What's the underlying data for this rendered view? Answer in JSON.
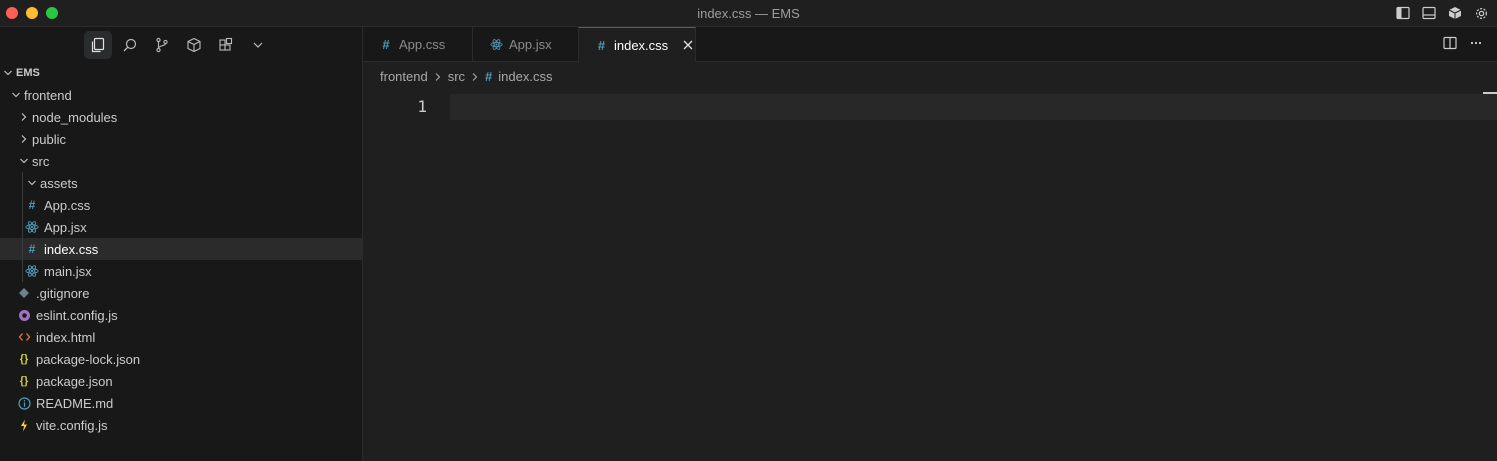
{
  "window": {
    "title": "index.css — EMS"
  },
  "colors": {
    "css_hash": "#519aba",
    "react": "#519aba",
    "json": "#cbcb41",
    "html": "#e37933",
    "eslint": "#a074c4",
    "vite": "#ffd62e",
    "info": "#519aba",
    "gitignore": "#6d8086",
    "accent": "#0078d4"
  },
  "explorer": {
    "root": "EMS",
    "items": [
      {
        "label": "frontend"
      },
      {
        "label": "node_modules"
      },
      {
        "label": "public"
      },
      {
        "label": "src"
      },
      {
        "label": "assets"
      },
      {
        "label": "App.css"
      },
      {
        "label": "App.jsx"
      },
      {
        "label": "index.css"
      },
      {
        "label": "main.jsx"
      },
      {
        "label": ".gitignore"
      },
      {
        "label": "eslint.config.js"
      },
      {
        "label": "index.html"
      },
      {
        "label": "package-lock.json"
      },
      {
        "label": "package.json"
      },
      {
        "label": "README.md"
      },
      {
        "label": "vite.config.js"
      }
    ]
  },
  "tabs": [
    {
      "label": "App.css"
    },
    {
      "label": "App.jsx"
    },
    {
      "label": "index.css"
    }
  ],
  "breadcrumb": [
    "frontend",
    "src",
    "index.css"
  ],
  "editor": {
    "line_number": "1"
  },
  "icons": {
    "hash": "#",
    "json_braces": "{}"
  }
}
